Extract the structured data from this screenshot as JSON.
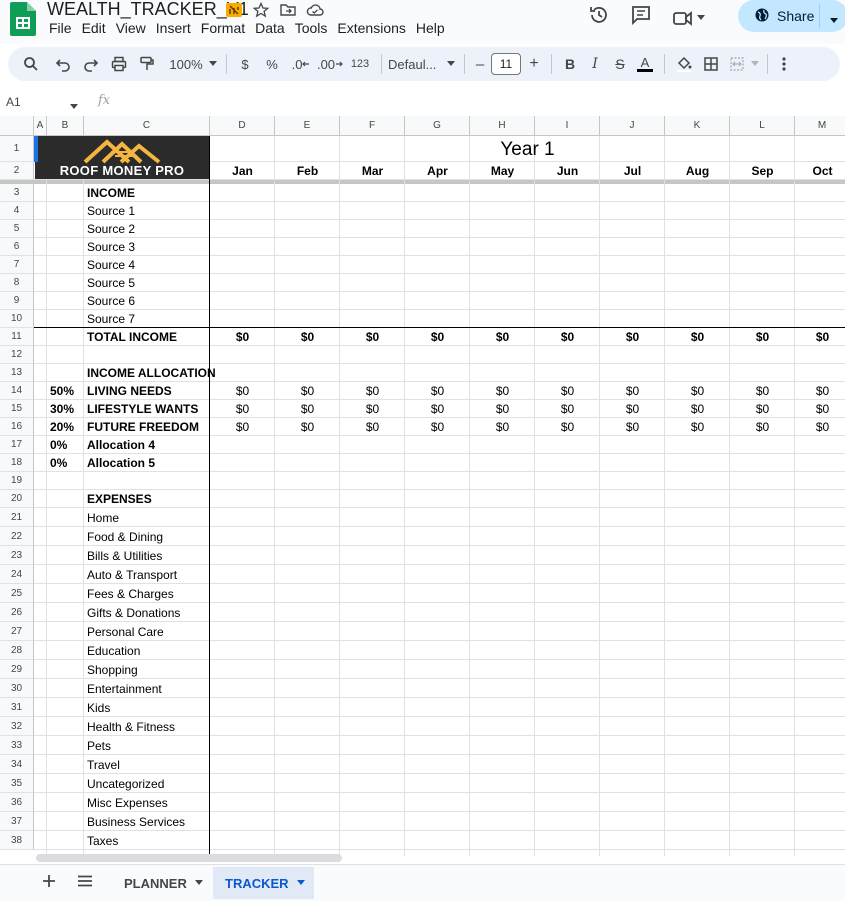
{
  "app": {
    "title": "WEALTH_TRACKER_V1",
    "menu": [
      "File",
      "Edit",
      "View",
      "Insert",
      "Format",
      "Data",
      "Tools",
      "Extensions",
      "Help"
    ],
    "share_label": "Share",
    "title_icons": [
      "no-sync-icon",
      "star-icon",
      "move-to-folder-icon",
      "cloud-saved-icon"
    ],
    "right_icons": [
      "version-history-icon",
      "comments-icon",
      "meet-icon"
    ]
  },
  "toolbar": {
    "zoom": "100%",
    "currency": "$",
    "percent": "%",
    "decrease_decimal": ".0",
    "increase_decimal": ".00",
    "number_format": "123",
    "font": "Defaul...",
    "font_size": "11",
    "minus": "–",
    "plus": "+",
    "bold": "B",
    "italic": "I",
    "strike": "S",
    "text_color": "A"
  },
  "formula_bar": {
    "name_box": "A1",
    "fx": "fx",
    "content": ""
  },
  "columns": [
    "A",
    "B",
    "C",
    "D",
    "E",
    "F",
    "G",
    "H",
    "I",
    "J",
    "K",
    "L",
    "M"
  ],
  "rows": [
    "1",
    "2",
    "3",
    "4",
    "5",
    "6",
    "7",
    "8",
    "9",
    "10",
    "11",
    "12",
    "13",
    "14",
    "15",
    "16",
    "17",
    "18",
    "19",
    "20",
    "21",
    "22",
    "23",
    "24",
    "25",
    "26",
    "27",
    "28",
    "29",
    "30",
    "31",
    "32",
    "33",
    "34",
    "35",
    "36",
    "37",
    "38"
  ],
  "logo_text": "ROOF MONEY PRO",
  "year_title": "Year 1",
  "months": [
    "Jan",
    "Feb",
    "Mar",
    "Apr",
    "May",
    "Jun",
    "Jul",
    "Aug",
    "Sep",
    "Oct"
  ],
  "income": {
    "header": "INCOME",
    "sources": [
      "Source 1",
      "Source 2",
      "Source 3",
      "Source 4",
      "Source 5",
      "Source 6",
      "Source 7"
    ],
    "total_label": "TOTAL INCOME",
    "total_values": [
      "$0",
      "$0",
      "$0",
      "$0",
      "$0",
      "$0",
      "$0",
      "$0",
      "$0",
      "$0"
    ]
  },
  "allocation": {
    "header": "INCOME ALLOCATION",
    "items": [
      {
        "pct": "50%",
        "label": "LIVING NEEDS",
        "values": [
          "$0",
          "$0",
          "$0",
          "$0",
          "$0",
          "$0",
          "$0",
          "$0",
          "$0",
          "$0"
        ]
      },
      {
        "pct": "30%",
        "label": "LIFESTYLE WANTS",
        "values": [
          "$0",
          "$0",
          "$0",
          "$0",
          "$0",
          "$0",
          "$0",
          "$0",
          "$0",
          "$0"
        ]
      },
      {
        "pct": "20%",
        "label": "FUTURE FREEDOM",
        "values": [
          "$0",
          "$0",
          "$0",
          "$0",
          "$0",
          "$0",
          "$0",
          "$0",
          "$0",
          "$0"
        ]
      },
      {
        "pct": "0%",
        "label": "Allocation 4",
        "values": []
      },
      {
        "pct": "0%",
        "label": "Allocation 5",
        "values": []
      }
    ]
  },
  "expenses": {
    "header": "EXPENSES",
    "items": [
      "Home",
      "Food & Dining",
      "Bills & Utilities",
      "Auto & Transport",
      "Fees & Charges",
      "Gifts & Donations",
      "Personal Care",
      "Education",
      "Shopping",
      "Entertainment",
      "Kids",
      "Health & Fitness",
      "Pets",
      "Travel",
      "Uncategorized",
      "Misc Expenses",
      "Business Services",
      "Taxes"
    ]
  },
  "sheets": [
    {
      "name": "PLANNER",
      "active": false
    },
    {
      "name": "TRACKER",
      "active": true
    }
  ],
  "colors": {
    "accent": "#0b57d0",
    "share_bg": "#c2e7ff",
    "toolbar_bg": "#edf2fa",
    "logo_bg": "#2b2b2b",
    "logo_gold": "#f4b63f"
  }
}
